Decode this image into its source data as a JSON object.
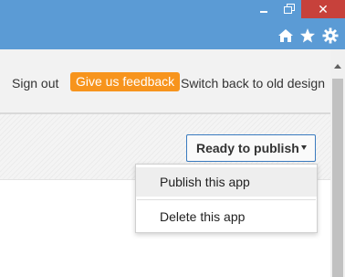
{
  "window": {
    "controls": {
      "minimize": "minimize-icon",
      "restore": "restore-icon",
      "close": "✕"
    },
    "toolbar_icons": [
      "home-icon",
      "star-icon",
      "gear-icon"
    ]
  },
  "nav": {
    "sign_out": "Sign out",
    "feedback": "Give us feedback",
    "switch_design": "Switch back to old design"
  },
  "publish_dropdown": {
    "selected": "Ready to publish",
    "options": [
      "Publish this app",
      "Delete this app"
    ]
  },
  "colors": {
    "titlebar": "#5b9bd5",
    "close_button": "#c7413b",
    "feedback_badge": "#f7941d",
    "dropdown_border": "#3a7bbf"
  }
}
